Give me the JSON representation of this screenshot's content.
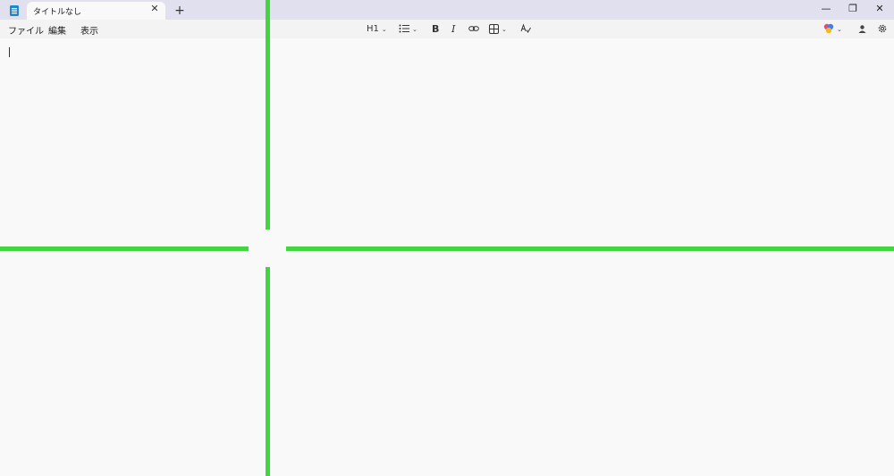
{
  "tab": {
    "title": "タイトルなし",
    "close": "✕",
    "new": "+"
  },
  "window": {
    "minimize": "—",
    "restore": "❐",
    "close": "✕"
  },
  "menu": {
    "file": "ファイル",
    "edit": "編集",
    "view": "表示"
  },
  "toolbar": {
    "heading": "H1",
    "bold": "B",
    "italic": "I"
  },
  "colors": {
    "titlebar": "#e0e0ef",
    "editor": "#f9f9f9",
    "overlay": "#3fd63f"
  }
}
